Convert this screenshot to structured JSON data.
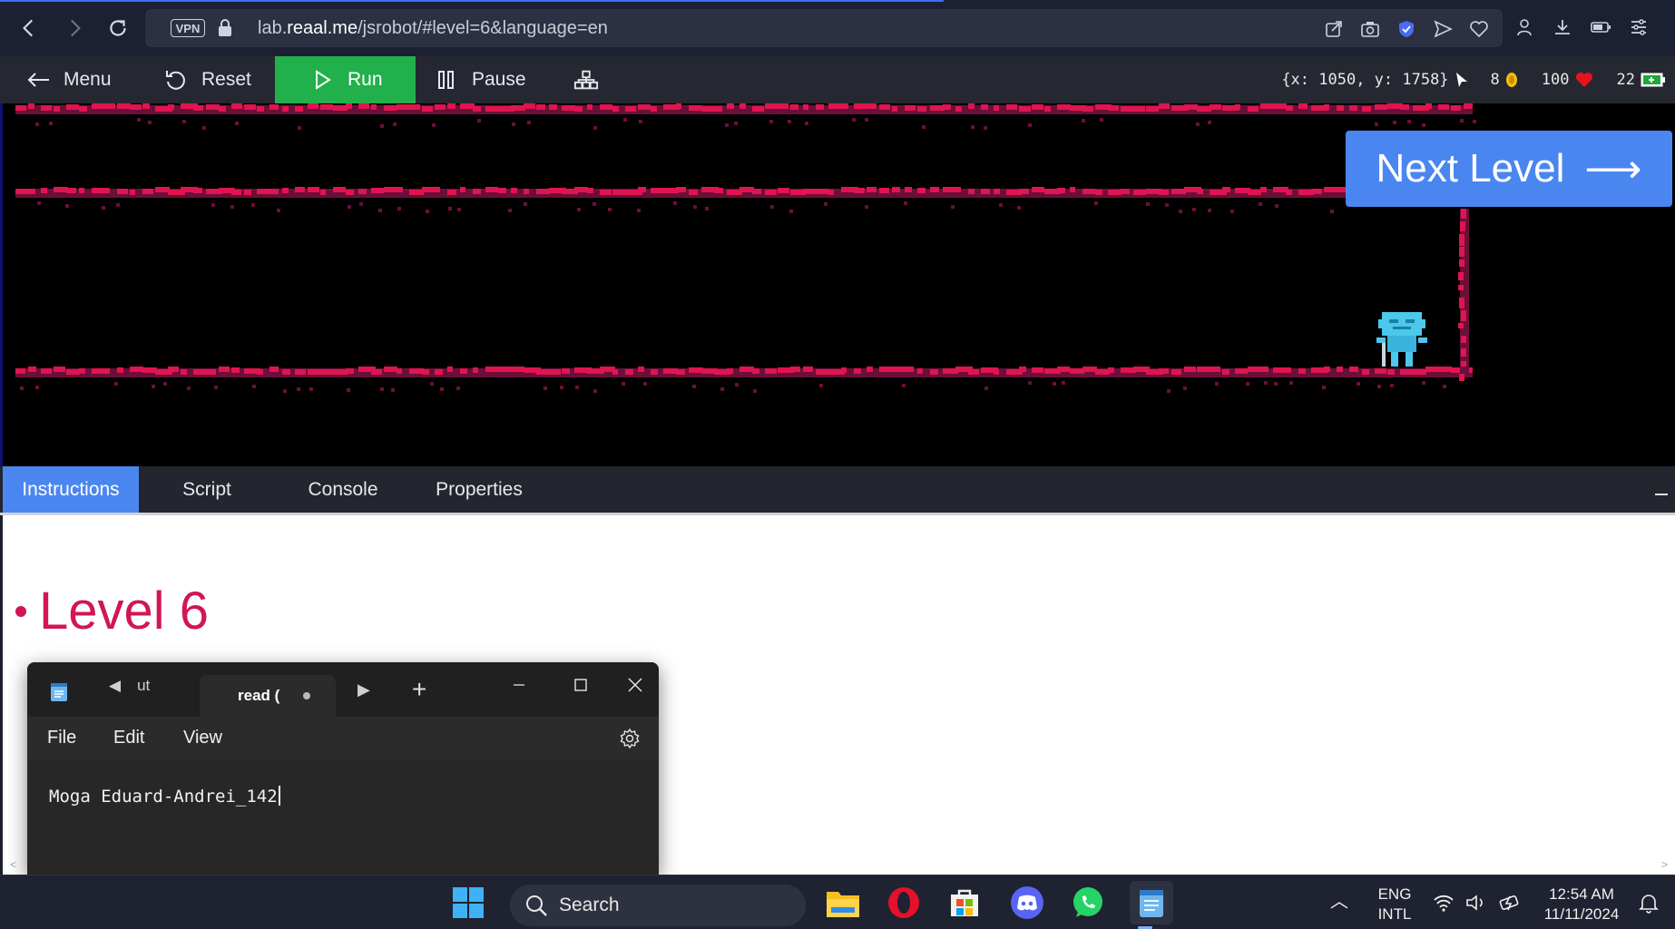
{
  "browser": {
    "url_prefix": "lab.",
    "url_domain": "reaal.me",
    "url_rest": "/jsrobot/#level=6&language=en",
    "vpn_label": "VPN"
  },
  "toolbar": {
    "menu_label": "Menu",
    "reset_label": "Reset",
    "run_label": "Run",
    "pause_label": "Pause",
    "coords": "{x: 1050, y: 1758}",
    "coins": "8",
    "health": "100",
    "energy": "22"
  },
  "game": {
    "next_level_label": "Next Level",
    "next_level_arrow": "⟶"
  },
  "tabs": [
    {
      "label": "Instructions",
      "active": true
    },
    {
      "label": "Script",
      "active": false
    },
    {
      "label": "Console",
      "active": false
    },
    {
      "label": "Properties",
      "active": false
    }
  ],
  "instructions": {
    "heading": "Level 6"
  },
  "notepad": {
    "tab_prev_label": "ut",
    "tab_active_label": "read (",
    "menu": {
      "file": "File",
      "edit": "Edit",
      "view": "View"
    },
    "content": "Moga Eduard-Andrei_142"
  },
  "taskbar": {
    "search_label": "Search",
    "lang_top": "ENG",
    "lang_bottom": "INTL",
    "time": "12:54 AM",
    "date": "11/11/2024"
  },
  "colors": {
    "accent_blue": "#4a86f0",
    "run_green": "#21b04b",
    "level_heading": "#d11654",
    "brick": "#e0144f",
    "brick_dark": "#6b0f3a",
    "robot": "#4cc8ec"
  }
}
